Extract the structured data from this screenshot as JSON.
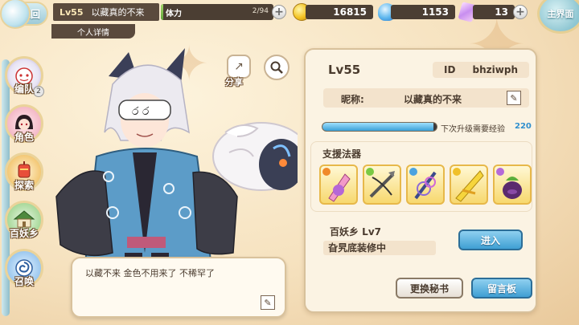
{
  "topbar": {
    "back_label": "返回",
    "level": "Lv55",
    "name": "以藏真的不来",
    "stamina_label": "体力",
    "stamina_value": "2/94",
    "stamina_fraction": 0.02,
    "gold": "16815",
    "jade": "1153",
    "crystal": "13",
    "main_world_label": "主界面"
  },
  "personal_tab": "个人详情",
  "nav": [
    {
      "label": "编队",
      "badge": "2"
    },
    {
      "label": "角色"
    },
    {
      "label": "探索"
    },
    {
      "label": "百妖乡"
    },
    {
      "label": "召唤"
    }
  ],
  "share_label": "分享",
  "speech_text": "以藏不来 金色不用来了 不稀罕了",
  "panel": {
    "level": "Lv55",
    "id_label": "ID",
    "id_value": "bhziwph",
    "nick_label": "昵称:",
    "nick_value": "以藏真的不来",
    "exp_label": "下次升级需要经验",
    "exp_value": "220",
    "exp_fraction": 0.97,
    "support_title": "支援法器",
    "home_name": "百妖乡  Lv7",
    "home_status": "旮旯底装修中",
    "enter_label": "进入",
    "secretary_label": "更换秘书",
    "message_label": "留言板"
  },
  "colors": {
    "accent_blue": "#3f9fd3",
    "panel_bg": "#fbf3e3",
    "text_dark": "#4a3b2e"
  }
}
